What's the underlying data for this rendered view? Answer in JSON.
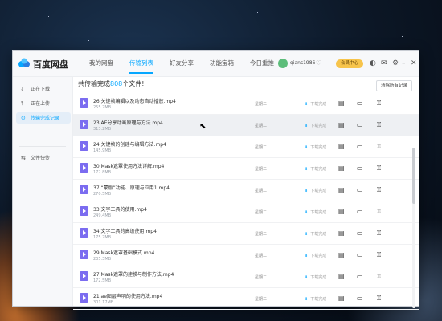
{
  "app": {
    "name": "百度网盘"
  },
  "nav": {
    "tabs": [
      {
        "label": "我的网盘",
        "active": false
      },
      {
        "label": "传输列表",
        "active": true
      },
      {
        "label": "好友分享",
        "active": false
      },
      {
        "label": "功能宝箱",
        "active": false
      },
      {
        "label": "今日重推",
        "active": false
      }
    ]
  },
  "user": {
    "name": "qians1986",
    "vip_label": "会员中心"
  },
  "sidebar": {
    "items": [
      {
        "label": "正在下载",
        "icon": "download-icon",
        "active": false
      },
      {
        "label": "正在上传",
        "icon": "upload-icon",
        "active": false
      },
      {
        "label": "传输完成记录",
        "icon": "check-circle-icon",
        "active": true
      },
      {
        "label": "文件快传",
        "icon": "send-icon",
        "active": false
      }
    ]
  },
  "summary": {
    "prefix": "共传输完成",
    "count": "808",
    "suffix": "个文件!"
  },
  "clear_button": "清除所有记录",
  "files": [
    {
      "name": "26.关键帧编辑以及动态自动播放.mp4",
      "size": "255.7MB",
      "date": "星期二",
      "status": "下载完成"
    },
    {
      "name": "23.AE分享动画原理与方法.mp4",
      "size": "313.2MB",
      "date": "星期二",
      "status": "下载完成"
    },
    {
      "name": "24.关键帧的创建与编辑方法.mp4",
      "size": "145.9MB",
      "date": "星期二",
      "status": "下载完成"
    },
    {
      "name": "30.Mask遮罩使用方法详解.mp4",
      "size": "172.8MB",
      "date": "星期二",
      "status": "下载完成"
    },
    {
      "name": "37.“蒙版”功能、原理与应用1.mp4",
      "size": "270.5MB",
      "date": "星期二",
      "status": "下载完成"
    },
    {
      "name": "33.文字工具的使用.mp4",
      "size": "249.4MB",
      "date": "星期二",
      "status": "下载完成"
    },
    {
      "name": "34.文字工具的高级使用.mp4",
      "size": "175.7MB",
      "date": "星期二",
      "status": "下载完成"
    },
    {
      "name": "29.Mask遮罩基础模式.mp4",
      "size": "235.3MB",
      "date": "星期二",
      "status": "下载完成"
    },
    {
      "name": "27.Mask遮罩的建模与制作方法.mp4",
      "size": "172.5MB",
      "date": "星期二",
      "status": "下载完成"
    },
    {
      "name": "21.ae图层声明的使用方法.mp4",
      "size": "301.17MB",
      "date": "星期二",
      "status": "下载完成"
    }
  ],
  "hover_row_index": 1,
  "colors": {
    "accent": "#06a7ff",
    "file_icon": "#7b6cf0",
    "vip": "#f7c44b"
  }
}
